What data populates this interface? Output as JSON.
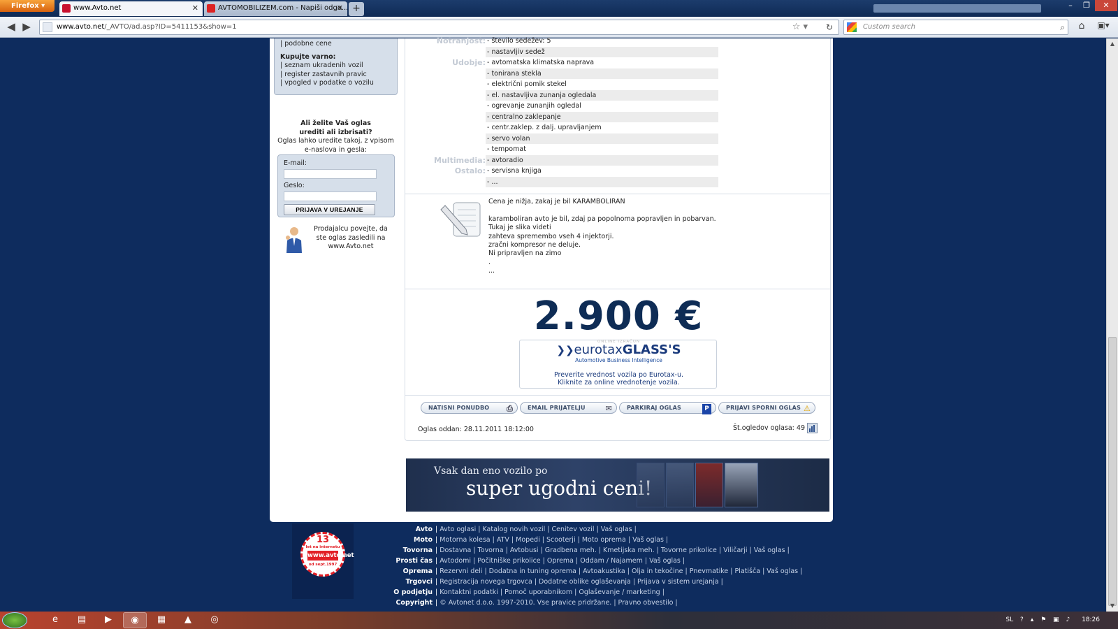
{
  "browser": {
    "app_button": "Firefox",
    "tabs": [
      {
        "title": "www.Avto.net"
      },
      {
        "title": "AVTOMOBILIZEM.com - Napiši odgo..."
      }
    ],
    "newtab_label": "+",
    "url_domain": "www.avto.net",
    "url_path": "/_AVTO/ad.asp?ID=5411153&show=1",
    "search_placeholder": "Custom search"
  },
  "sidebar": {
    "top_link": "| podobne cene",
    "safe_heading": "Kupujte varno:",
    "safe_links": [
      "| seznam ukradenih vozil",
      "| register zastavnih pravic",
      "| vpogled v podatke o vozilu"
    ],
    "edit_heading_1": "Ali želite Vaš oglas",
    "edit_heading_2": "urediti ali izbrisati?",
    "edit_text": "Oglas lahko uredite takoj, z vpisom e-naslova in gesla:",
    "email_label": "E-mail:",
    "password_label": "Geslo:",
    "login_button": "PRIJAVA V UREJANJE",
    "seller_note": "Prodajalcu povejte, da ste oglas zasledili na www.Avto.net"
  },
  "features": [
    {
      "label": "Notranjost:",
      "value": "- število sedežev: 5"
    },
    {
      "label": "",
      "value": "- nastavljiv sedež"
    },
    {
      "label": "Udobje:",
      "value": "- avtomatska klimatska naprava"
    },
    {
      "label": "",
      "value": "- tonirana stekla"
    },
    {
      "label": "",
      "value": "- električni pomik stekel"
    },
    {
      "label": "",
      "value": "- el. nastavljiva zunanja ogledala"
    },
    {
      "label": "",
      "value": "- ogrevanje zunanjih ogledal"
    },
    {
      "label": "",
      "value": "- centralno zaklepanje"
    },
    {
      "label": "",
      "value": "- centr.zaklep. z dalj. upravljanjem"
    },
    {
      "label": "",
      "value": "- servo volan"
    },
    {
      "label": "",
      "value": "- tempomat"
    },
    {
      "label": "Multimedia:",
      "value": "- avtoradio"
    },
    {
      "label": "Ostalo:",
      "value": "- servisna knjiga"
    },
    {
      "label": "",
      "value": "- ..."
    }
  ],
  "description": [
    "Cena je nižja, zakaj je bil KARAMBOLIRAN",
    "",
    "karamboliran avto je bil, zdaj pa popolnoma popravljen in pobarvan.",
    "Tukaj je slika videti",
    "zahteva spremembo vseh 4 injektorji.",
    "zračni kompresor ne deluje.",
    "Ni pripravljen na zimo",
    ".",
    "..."
  ],
  "price": "2.900 €",
  "eurotax": {
    "online": "ONLINE IZRAČUN",
    "logo_left": "eurotax",
    "logo_right": "GLASS'S",
    "subtitle": "Automotive Business Intelligence",
    "line1": "Preverite vrednost vozila po Eurotax-u.",
    "line2": "Kliknite za online vrednotenje vozila."
  },
  "actions": {
    "print": "NATISNI PONUDBO",
    "email": "EMAIL PRIJATELJU",
    "park": "PARKIRAJ OGLAS",
    "report": "PRIJAVI SPORNI OGLAS"
  },
  "ad_posted": "Oglas oddan: 28.11.2011 18:12:00",
  "views": "Št.ogledov oglasa: 49",
  "banner": {
    "line1": "Vsak dan eno vozilo po",
    "line2": "super ugodni ceni!"
  },
  "badge": {
    "number": "13",
    "top": "let na internetu",
    "site": "www.avto.net",
    "since": "od sept.1997"
  },
  "footer": [
    {
      "key": "Avto",
      "links": "Avto oglasi | Katalog novih vozil | Cenitev vozil | Vaš oglas |"
    },
    {
      "key": "Moto",
      "links": "Motorna kolesa | ATV | Mopedi | Scooterji | Moto oprema | Vaš oglas |"
    },
    {
      "key": "Tovorna",
      "links": "Dostavna | Tovorna | Avtobusi | Gradbena meh. | Kmetijska meh. | Tovorne prikolice | Viličarji | Vaš oglas |"
    },
    {
      "key": "Prosti čas",
      "links": "Avtodomi | Počitniške prikolice | Oprema | Oddam / Najamem | Vaš oglas |"
    },
    {
      "key": "Oprema",
      "links": "Rezervni deli | Dodatna in tuning oprema | Avtoakustika | Olja in tekočine | Pnevmatike | Platišča | Vaš oglas |"
    },
    {
      "key": "Trgovci",
      "links": "Registracija novega trgovca | Dodatne oblike oglaševanja | Prijava v sistem urejanja |"
    },
    {
      "key": "O podjetju",
      "links": "Kontaktni podatki | Pomoč uporabnikom | Oglaševanje / marketing |"
    },
    {
      "key": "Copyright",
      "links": "© Avtonet d.o.o. 1997-2010. Vse pravice pridržane. | Pravno obvestilo |"
    }
  ],
  "taskbar": {
    "lang": "SL",
    "clock": "18:26"
  },
  "colors": {
    "page_bg": "#0e2c5e",
    "price": "#0e2c55",
    "box_bg": "#d6dfea"
  }
}
